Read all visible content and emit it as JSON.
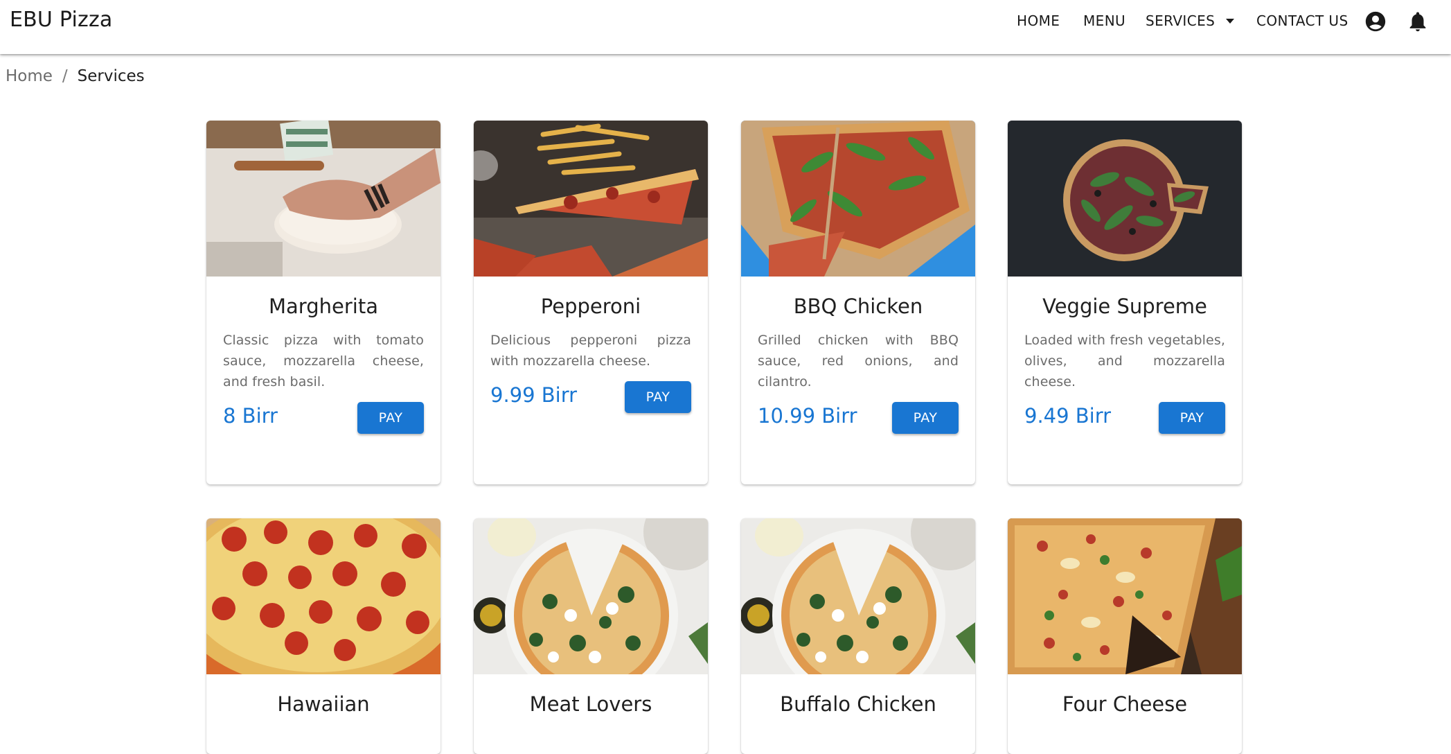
{
  "header": {
    "brand": "EBU Pizza",
    "nav": {
      "home": "HOME",
      "menu": "MENU",
      "services": "SERVICES",
      "contact": "CONTACT US"
    },
    "icons": [
      "account-circle-icon",
      "bell-icon",
      "chevron-down-icon"
    ]
  },
  "breadcrumb": {
    "home": "Home",
    "separator": "/",
    "current": "Services"
  },
  "products": [
    {
      "name": "Margherita",
      "description": "Classic pizza with tomato sauce, mozzarella cheese, and fresh basil.",
      "price": "8 Birr",
      "button": "PAY"
    },
    {
      "name": "Pepperoni",
      "description": "Delicious pepperoni pizza with mozzarella cheese.",
      "price": "9.99 Birr",
      "button": "PAY"
    },
    {
      "name": "BBQ Chicken",
      "description": "Grilled chicken with BBQ sauce, red onions, and cilantro.",
      "price": "10.99 Birr",
      "button": "PAY"
    },
    {
      "name": "Veggie Supreme",
      "description": "Loaded with fresh vegetables, olives, and mozzarella cheese.",
      "price": "9.49 Birr",
      "button": "PAY"
    },
    {
      "name": "Hawaiian"
    },
    {
      "name": "Meat Lovers"
    },
    {
      "name": "Buffalo Chicken"
    },
    {
      "name": "Four Cheese"
    }
  ],
  "colors": {
    "accent": "#1976d2",
    "text": "#212121",
    "muted": "#6b6b6b"
  }
}
